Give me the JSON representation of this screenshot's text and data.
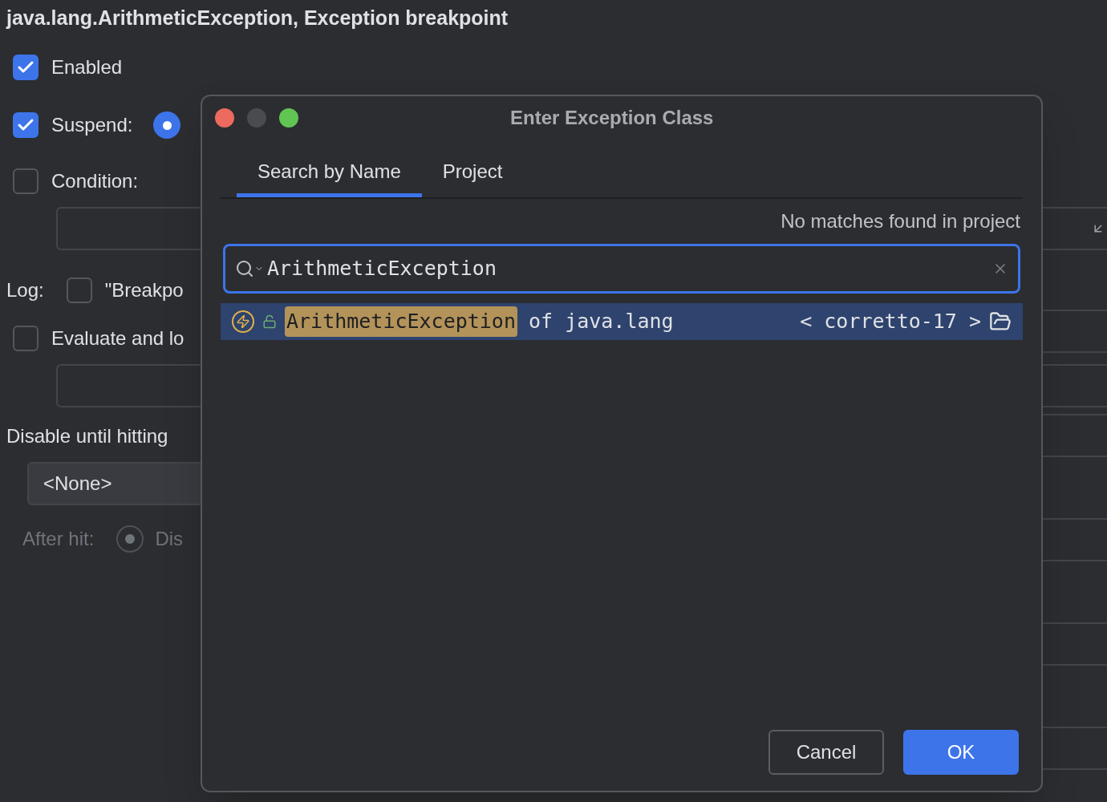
{
  "editor_title": "java.lang.ArithmeticException, Exception breakpoint",
  "enabled": {
    "label": "Enabled",
    "checked": true
  },
  "suspend": {
    "label": "Suspend:",
    "checked": true,
    "radio_selected": true
  },
  "condition": {
    "label": "Condition:",
    "checked": false
  },
  "log": {
    "label": "Log:",
    "checked": false,
    "option_label": "\"Breakpo"
  },
  "evaluate": {
    "label": "Evaluate and lo",
    "checked": false
  },
  "disable_until": {
    "label": "Disable until hitting",
    "value": "<None>"
  },
  "after_hit": {
    "label": "After hit:",
    "disabled": true,
    "selected": true,
    "option_label": "Dis"
  },
  "dialog": {
    "title": "Enter Exception Class",
    "tabs": [
      {
        "label": "Search by Name",
        "selected": true
      },
      {
        "label": "Project",
        "selected": false
      }
    ],
    "status": "No matches found in project",
    "search": {
      "value": "ArithmeticException"
    },
    "results": [
      {
        "name": "ArithmeticException",
        "package": "of java.lang",
        "library": "< corretto-17 >",
        "selected": true
      }
    ],
    "buttons": [
      {
        "label": "Cancel",
        "kind": "secondary"
      },
      {
        "label": "OK",
        "kind": "primary"
      }
    ]
  }
}
